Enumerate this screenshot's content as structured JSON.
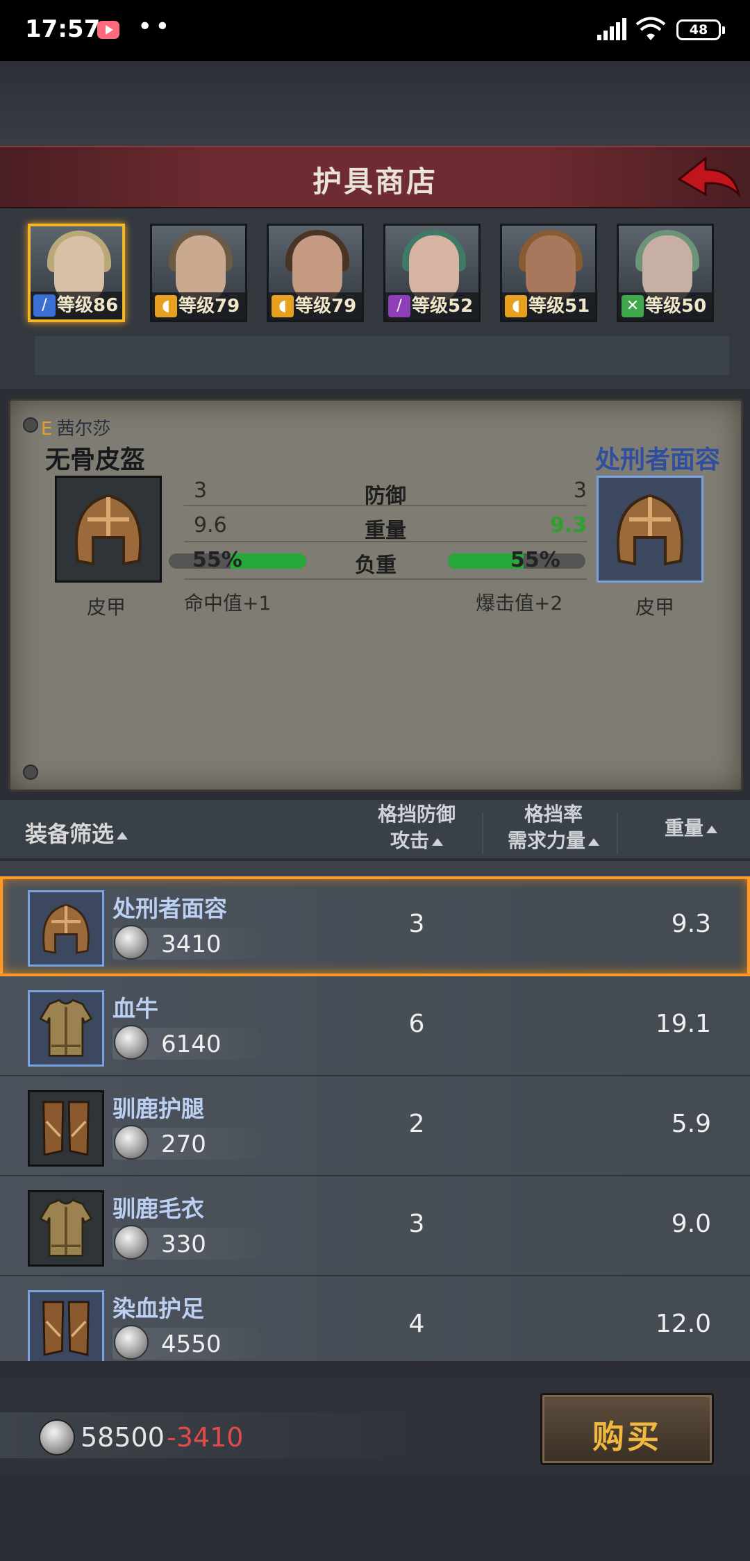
{
  "status_bar": {
    "time": "17:57",
    "dots": "••",
    "battery": "48"
  },
  "header": {
    "title": "护具商店"
  },
  "heroes": [
    {
      "level": "等级86",
      "class_icon": "sword-icon",
      "selected": true
    },
    {
      "level": "等级79",
      "class_icon": "shield-icon"
    },
    {
      "level": "等级79",
      "class_icon": "shield-icon"
    },
    {
      "level": "等级52",
      "class_icon": "staff-icon"
    },
    {
      "level": "等级51",
      "class_icon": "shield-icon"
    },
    {
      "level": "等级50",
      "class_icon": "bow-icon"
    }
  ],
  "compare": {
    "owner_tag": "E",
    "owner": "茜尔莎",
    "left_name": "无骨皮盔",
    "right_name": "处刑者面容",
    "left_type": "皮甲",
    "right_type": "皮甲",
    "stats": [
      {
        "label": "防御",
        "left": "3",
        "right": "3"
      },
      {
        "label": "重量",
        "left": "9.6",
        "right": "9.3"
      }
    ],
    "load_label": "负重",
    "left_load": "55%",
    "right_load": "55%",
    "left_load_fraction": 0.55,
    "right_load_fraction": 0.55,
    "left_bonus": "命中值+1",
    "right_bonus": "爆击值+2"
  },
  "list_header": {
    "filter": "装备筛选",
    "col1_line1": "格挡防御",
    "col1_line2": "攻击",
    "col2_line1": "格挡率",
    "col2_line2": "需求力量",
    "col3": "重量"
  },
  "items": [
    {
      "name": "处刑者面容",
      "price": "3410",
      "value": "3",
      "weight": "9.3",
      "selected": true,
      "kind": "helmet"
    },
    {
      "name": "血牛",
      "price": "6140",
      "value": "6",
      "weight": "19.1",
      "kind": "armor"
    },
    {
      "name": "驯鹿护腿",
      "price": "270",
      "value": "2",
      "weight": "5.9",
      "kind": "legs"
    },
    {
      "name": "驯鹿毛衣",
      "price": "330",
      "value": "3",
      "weight": "9.0",
      "kind": "armor"
    },
    {
      "name": "染血护足",
      "price": "4550",
      "value": "4",
      "weight": "12.0",
      "kind": "legs"
    }
  ],
  "footer": {
    "money": "58500",
    "cost": "-3410",
    "buy_label": "购买"
  },
  "colors": {
    "accent": "#f2b62a",
    "title_bar": "#6e2b31",
    "negative": "#e34a4a",
    "positive": "#2fa02f"
  }
}
